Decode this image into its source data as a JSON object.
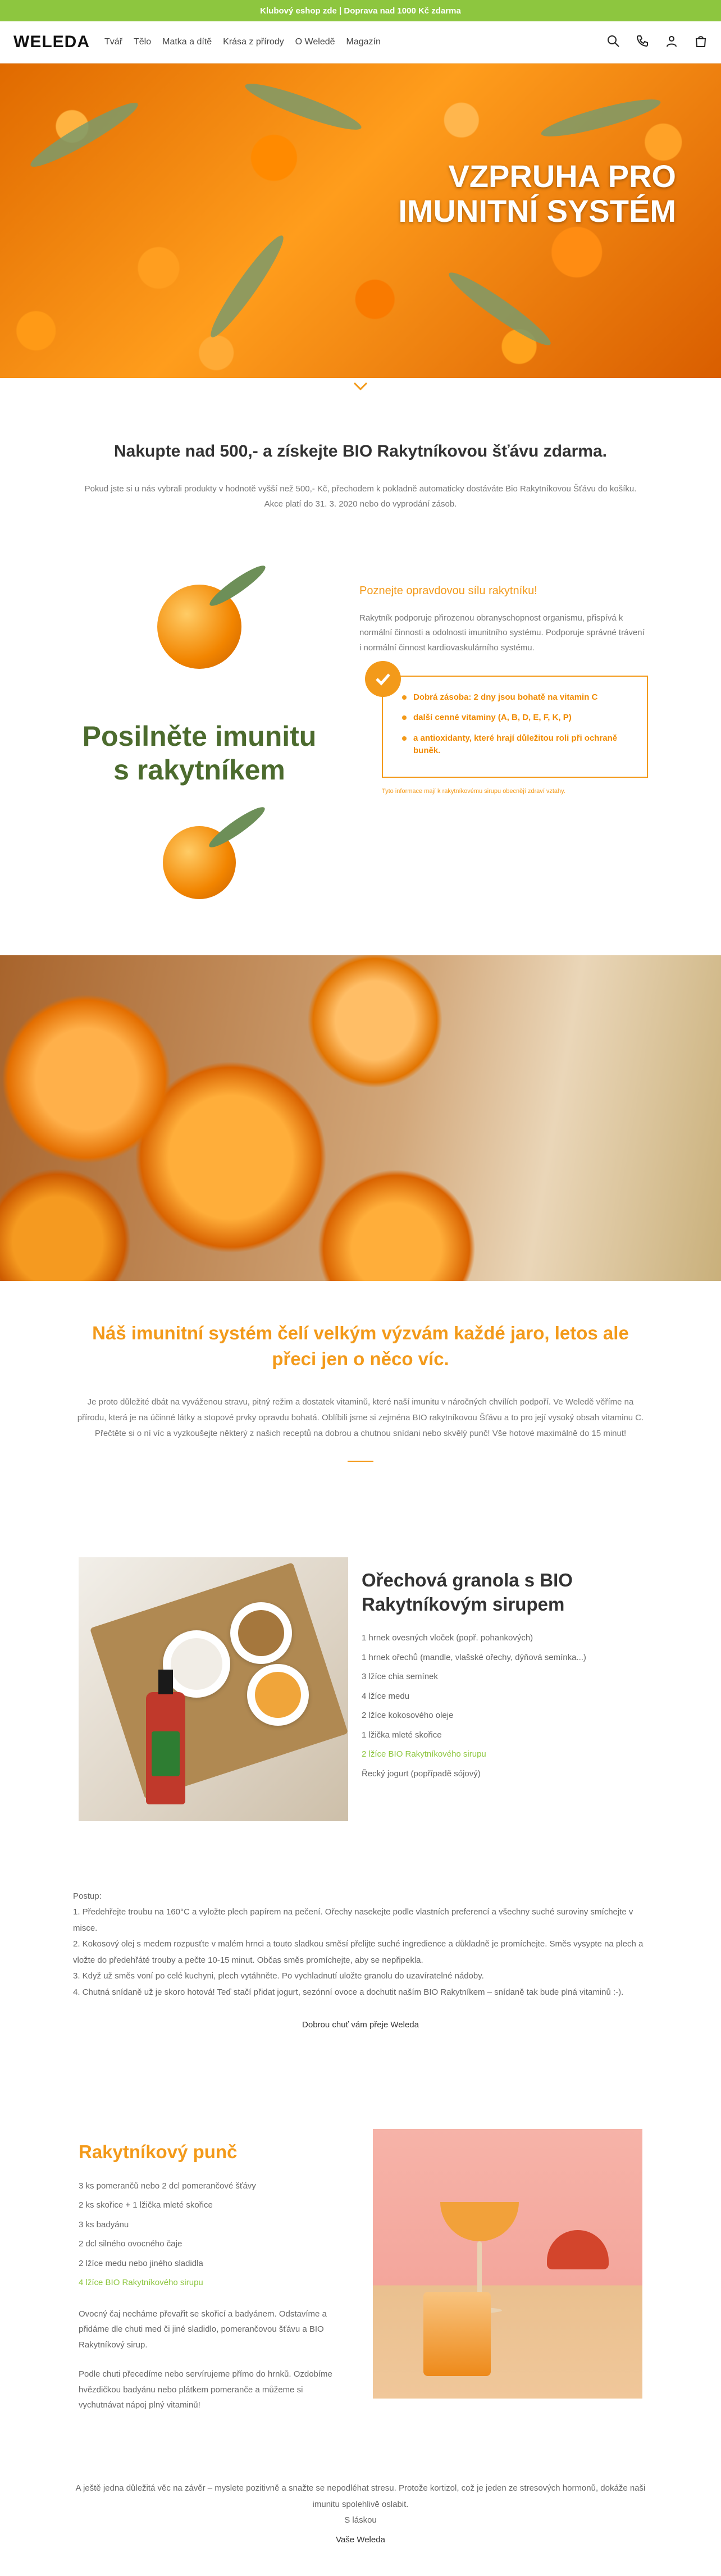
{
  "promo": "Klubový eshop zde | Doprava nad 1000 Kč zdarma",
  "header": {
    "logo": "WELEDA",
    "nav": [
      "Tvář",
      "Tělo",
      "Matka a dítě",
      "Krása z přírody",
      "O Weledě",
      "Magazín"
    ],
    "icons": [
      "search-icon",
      "phone-icon",
      "user-icon",
      "cart-icon"
    ]
  },
  "hero": {
    "title_line1": "VZPRUHA PRO",
    "title_line2": "IMUNITNÍ SYSTÉM"
  },
  "offer": {
    "title": "Nakupte nad 500,- a získejte BIO Rakytníkovou šťávu zdarma.",
    "text": "Pokud jste si u nás vybrali produkty v hodnotě vyšší než 500,- Kč, přechodem k pokladně automaticky dostáváte Bio Rakytníkovou Šťávu do košíku. Akce platí do 31. 3. 2020 nebo do vyprodání zásob."
  },
  "immunity": {
    "title_line1": "Posilněte imunitu",
    "title_line2": "s rakytníkem",
    "subtitle": "Poznejte opravdovou sílu rakytníku!",
    "text": "Rakytník podporuje přirozenou obranyschopnost organismu, přispívá k normální činnosti a odolnosti imunitního systému. Podporuje správné trávení i normální činnost kardiovaskulárního systému.",
    "bullets": [
      "Dobrá zásoba: 2 dny jsou bohatě na vitamin C",
      "další cenné vitaminy (A, B, D, E, F, K, P)",
      "a antioxidanty, které hrají důležitou roli při ochraně buněk."
    ],
    "note": "Tyto informace mají k rakytníkovému sirupu obecnějí zdraví vztahy."
  },
  "intro": {
    "title": "Náš imunitní systém čelí velkým výzvám každé jaro, letos ale přeci jen o něco víc.",
    "text": "Je proto důležité dbát na vyváženou stravu, pitný režim a dostatek vitaminů, které naší imunitu v náročných chvílích podpoří. Ve Weledě věříme na přírodu, která je na účinné látky a stopové prvky opravdu bohatá. Oblíbili jsme si zejména BIO rakytníkovou Šťávu a to pro její vysoký obsah vitaminu C. Přečtěte si o ní víc a vyzkoušejte některý z našich receptů na dobrou a chutnou snídani nebo skvělý punč! Vše hotové maximálně do 15 minut!"
  },
  "recipe1": {
    "title_line1": "Ořechová granola s BIO",
    "title_line2": "Rakytníkovým sirupem",
    "ingredients": [
      "1 hrnek ovesných vloček (popř. pohankových)",
      "1 hrnek ořechů (mandle, vlašské ořechy, dýňová semínka...)",
      "3 lžíce chia semínek",
      "4 lžíce medu",
      "2 lžíce kokosového oleje",
      "1 lžička mleté skořice",
      "2 lžíce BIO Rakytníkového sirupu",
      "Řecký jogurt (popřípadě sójový)"
    ],
    "steps_title": "Postup:",
    "steps": [
      "1. Předehřejte troubu na 160°C a vyložte plech papírem na pečení. Ořechy nasekejte podle vlastních preferencí a všechny suché suroviny smíchejte v misce.",
      "2. Kokosový olej s medem rozpusťte v malém hrnci a touto sladkou směsí přelijte suché ingredience a důkladně je promíchejte. Směs vysypte na plech a vložte do předehřáté trouby a pečte 10-15 minut. Občas směs promíchejte, aby se nepřipekla.",
      "3. Když už směs voní po celé kuchyni, plech vytáhněte. Po vychladnutí uložte granolu do uzavíratelné nádoby.",
      "4. Chutná snídaně už je skoro hotová! Teď stačí přidat jogurt, sezónní ovoce a dochutit naším BIO Rakytníkem – snídaně tak bude plná vitaminů :-)."
    ],
    "signoff": "Dobrou chuť vám přeje Weleda"
  },
  "recipe2": {
    "title": "Rakytníkový punč",
    "ingredients": [
      "3 ks pomerančů nebo 2 dcl pomerančové šťávy",
      "2 ks skořice + 1 lžička mleté skořice",
      "3 ks badyánu",
      "2 dcl silného ovocného čaje",
      "2 lžíce medu nebo jiného sladidla",
      "4 lžíce BIO Rakytníkového sirupu"
    ],
    "para1": "Ovocný čaj necháme převařit se skořicí a badyánem. Odstavíme a přidáme dle chuti med či jiné sladidlo, pomerančovou šťávu a BIO Rakytníkový sirup.",
    "para2": "Podle chuti přecedíme nebo servírujeme přímo do hrnků. Ozdobíme hvězdičkou badyánu nebo plátkem pomeranče a můžeme si vychutnávat nápoj plný vitaminů!"
  },
  "closing": {
    "text": "A ještě jedna důležitá věc na závěr – myslete pozitivně a snažte se nepodléhat stresu. Protože kortizol, což je jeden ze stresových hormonů, dokáže naši imunitu spolehlivě oslabit.",
    "tagline": "S láskou",
    "signature": "Vaše Weleda"
  }
}
